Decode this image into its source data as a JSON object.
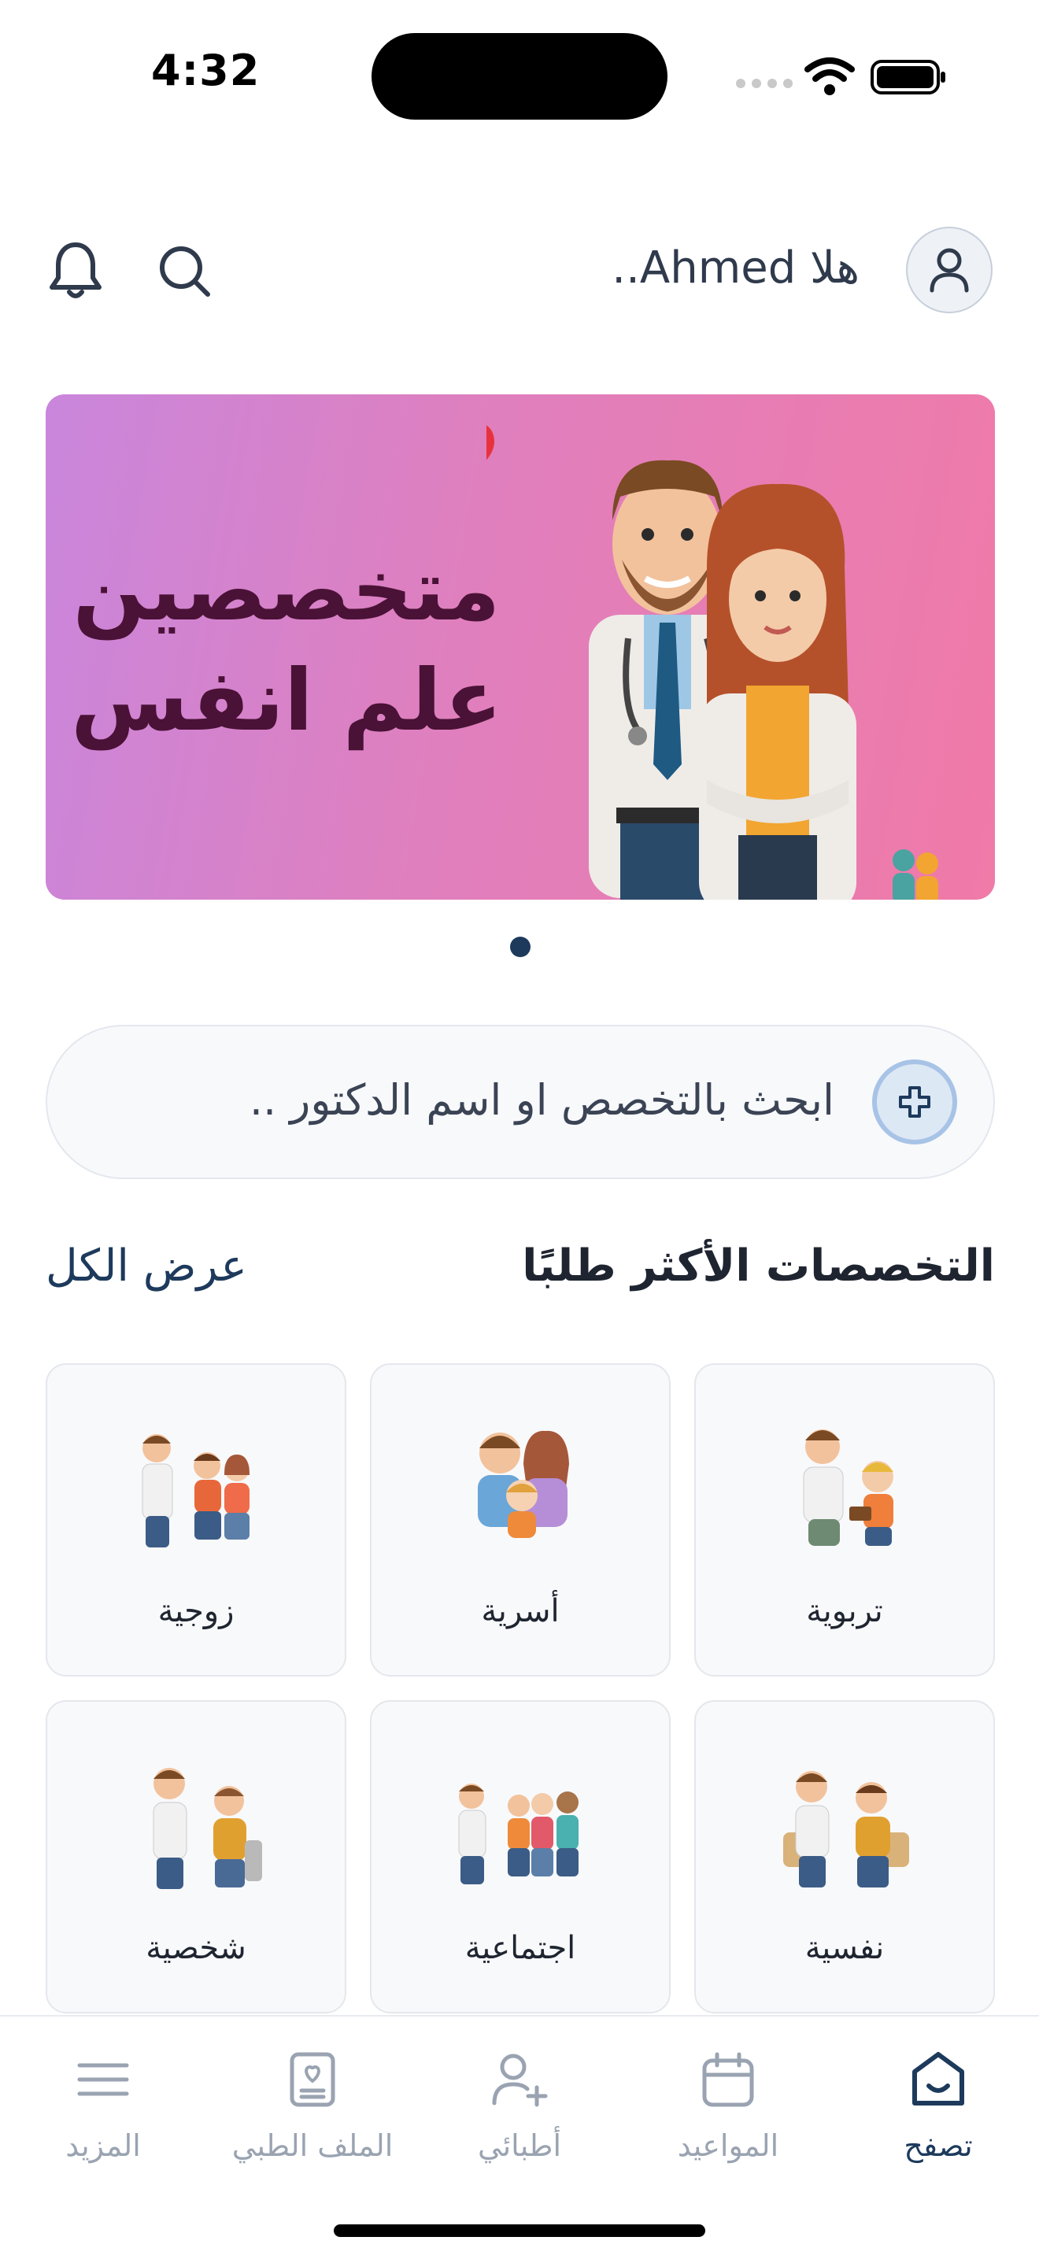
{
  "status_bar": {
    "time": "4:32"
  },
  "header": {
    "greeting": "هلا Ahmed..",
    "icons": [
      "bell-icon",
      "search-icon",
      "user-icon"
    ]
  },
  "banner": {
    "line1": "متخصصين",
    "line2": "علم انفس",
    "gradient": [
      "#c986dc",
      "#f07aa8"
    ],
    "title_color": "#4a1236"
  },
  "search": {
    "placeholder": "ابحث بالتخصص او اسم الدكتور .."
  },
  "section": {
    "title": "التخصصات الأكثر طلبًا",
    "view_all": "عرض الكل"
  },
  "specialties": [
    {
      "label": "تربوية"
    },
    {
      "label": "أسرية"
    },
    {
      "label": "زوجية"
    },
    {
      "label": "نفسية"
    },
    {
      "label": "اجتماعية"
    },
    {
      "label": "شخصية"
    }
  ],
  "nav": {
    "browse": "تصفح",
    "appointments": "المواعيد",
    "my_doctors": "أطبائي",
    "medical_file": "الملف الطبي",
    "more": "المزيد",
    "active_color": "#1d3a5c",
    "inactive_color": "#9aa3b1"
  }
}
